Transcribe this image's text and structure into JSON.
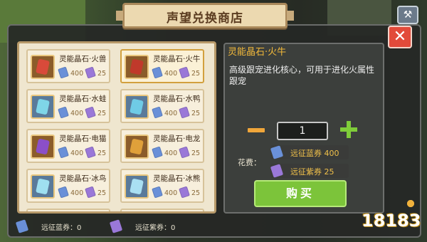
{
  "window": {
    "title": "声望兑换商店"
  },
  "buttons": {
    "close": "✕",
    "tool": "⚒"
  },
  "items": [
    {
      "name": "灵能晶石·火兽",
      "blue_price": "400",
      "purple_price": "25",
      "gem_color": "#d84a3a"
    },
    {
      "name": "灵能晶石·火牛",
      "blue_price": "400",
      "purple_price": "25",
      "gem_color": "#c0392b",
      "selected": true
    },
    {
      "name": "灵能晶石·水蛙",
      "blue_price": "400",
      "purple_price": "25",
      "gem_color": "#7fd6e8"
    },
    {
      "name": "灵能晶石·水鸭",
      "blue_price": "400",
      "purple_price": "25",
      "gem_color": "#6fcbe6"
    },
    {
      "name": "灵能晶石·电猫",
      "blue_price": "400",
      "purple_price": "25",
      "gem_color": "#8b4fc8"
    },
    {
      "name": "灵能晶石·电龙",
      "blue_price": "400",
      "purple_price": "25",
      "gem_color": "#e0a03a"
    },
    {
      "name": "灵能晶石·冰鸟",
      "blue_price": "400",
      "purple_price": "25",
      "gem_color": "#9fe0f0"
    },
    {
      "name": "灵能晶石·冰熊",
      "blue_price": "400",
      "purple_price": "25",
      "gem_color": "#a9dff2"
    }
  ],
  "footer": {
    "blue_label": "远征蓝券：0",
    "purple_label": "远征紫券：0"
  },
  "detail": {
    "title": "灵能晶石·火牛",
    "description": "高级跟宠进化核心，可用于进化火属性跟宠",
    "quantity": "1",
    "minus_label": "",
    "cost_label": "花费：",
    "cost_blue": "远征蓝券 400",
    "cost_purple": "远征紫券 25",
    "buy_label": "购买"
  },
  "watermark": {
    "text": "18183"
  },
  "colors": {
    "accent_gold": "#f2b93a",
    "buy_green": "#7cc43a",
    "close_red": "#e24a3a",
    "ticket_blue": "#6a90d8",
    "ticket_purple": "#9a78d8"
  }
}
